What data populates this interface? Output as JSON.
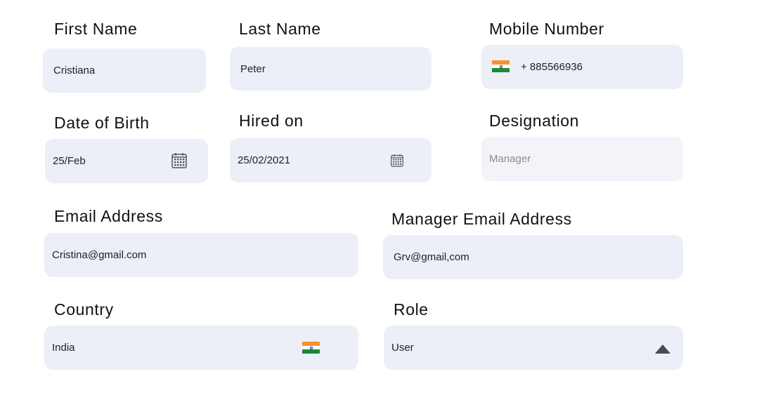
{
  "form": {
    "first_name": {
      "label": "First Name",
      "value": "Cristiana"
    },
    "last_name": {
      "label": "Last Name",
      "value": "Peter"
    },
    "mobile": {
      "label": "Mobile Number",
      "value": "+ 885566936",
      "flag_icon": "india-flag-icon"
    },
    "dob": {
      "label": "Date of Birth",
      "value": "25/Feb",
      "icon": "calendar-icon"
    },
    "hired_on": {
      "label": "Hired on",
      "value": "25/02/2021",
      "icon": "calendar-icon"
    },
    "designation": {
      "label": "Designation",
      "value": "Manager"
    },
    "email": {
      "label": "Email Address",
      "value": "Cristina@gmail.com"
    },
    "manager_email": {
      "label": "Manager Email Address",
      "value": "Grv@gmail,com"
    },
    "country": {
      "label": "Country",
      "value": "India",
      "flag_icon": "india-flag-icon"
    },
    "role": {
      "label": "Role",
      "value": "User",
      "icon": "caret-up-icon"
    }
  },
  "colors": {
    "field_bg": "#eceff7",
    "text": "#111111",
    "saffron": "#f7932b",
    "green": "#1a8a3a"
  }
}
